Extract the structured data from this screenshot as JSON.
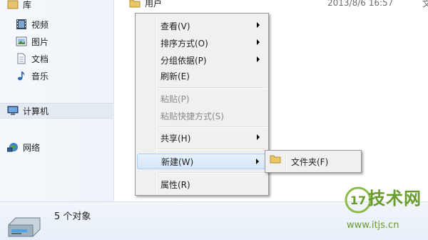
{
  "nav": {
    "library": "库",
    "videos": "视频",
    "pictures": "图片",
    "documents": "文档",
    "music": "音乐",
    "computer": "计算机",
    "network": "网络"
  },
  "file": {
    "name": "用户",
    "date": "2013/8/6 16:57",
    "type": "文"
  },
  "details": {
    "count": "5 个对象"
  },
  "menu": {
    "view": "查看(V)",
    "sort": "排序方式(O)",
    "group": "分组依据(P)",
    "refresh": "刷新(E)",
    "paste": "粘贴(P)",
    "paste_shortcut": "粘贴快捷方式(S)",
    "share": "共享(H)",
    "new": "新建(W)",
    "properties": "属性(R)"
  },
  "submenu": {
    "folder": "文件夹(F)"
  },
  "watermark": {
    "title": "技术网",
    "url": "www.itjs.cn",
    "logo_text": "17"
  },
  "colors": {
    "accent": "#aecff7",
    "watermark": "#6a9b2f"
  }
}
